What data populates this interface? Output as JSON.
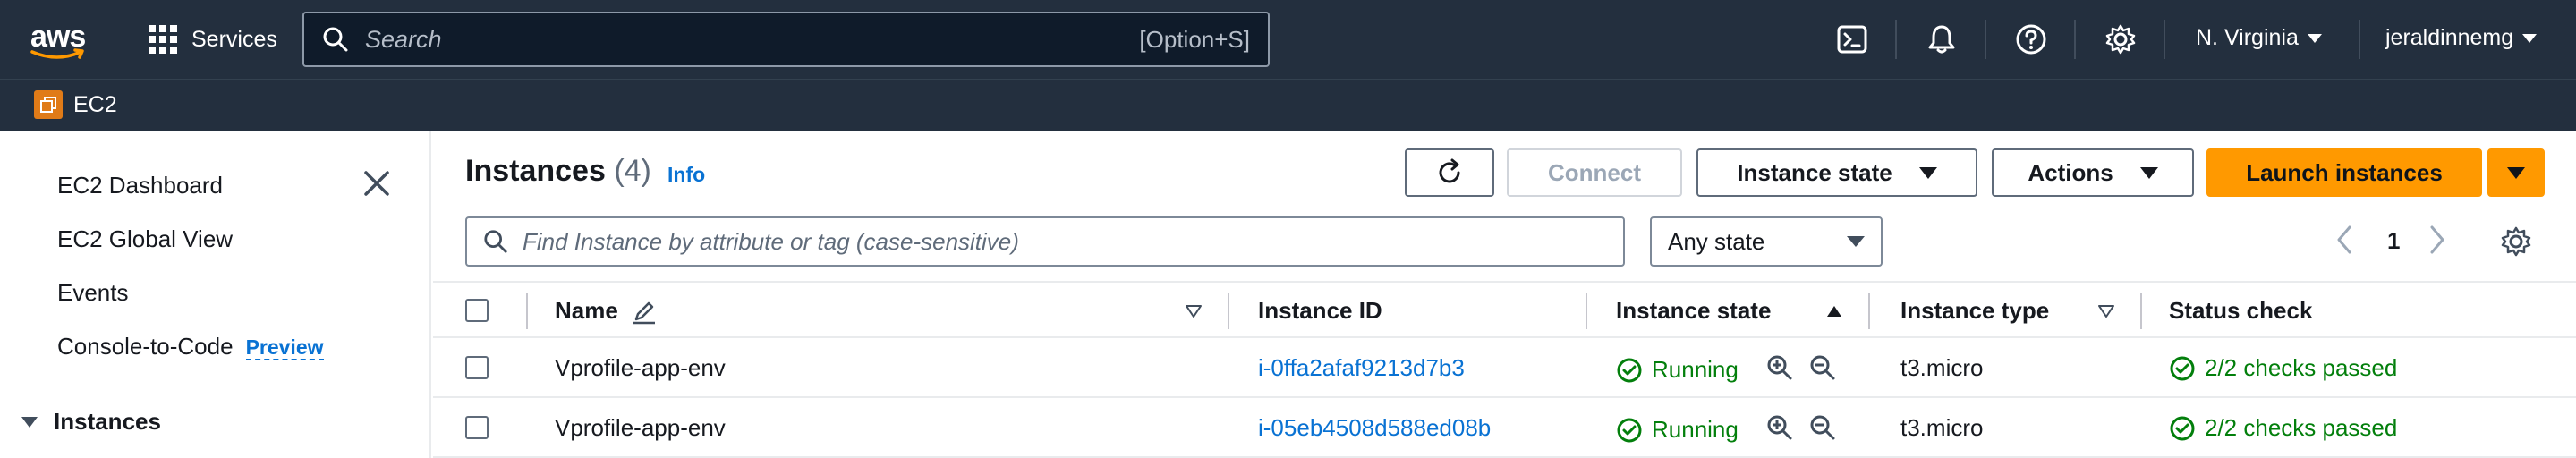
{
  "topnav": {
    "logo_text": "aws",
    "services_label": "Services",
    "search_placeholder": "Search",
    "search_shortcut": "[Option+S]",
    "region": "N. Virginia",
    "user": "jeraldinnemg"
  },
  "servicebar": {
    "service": "EC2"
  },
  "sidebar": {
    "items": [
      {
        "label": "EC2 Dashboard"
      },
      {
        "label": "EC2 Global View"
      },
      {
        "label": "Events"
      },
      {
        "label": "Console-to-Code"
      }
    ],
    "preview_label": "Preview",
    "section": "Instances"
  },
  "main": {
    "title": "Instances",
    "count": "(4)",
    "info": "Info",
    "connect_label": "Connect",
    "instance_state_label": "Instance state",
    "actions_label": "Actions",
    "launch_label": "Launch instances",
    "filter_placeholder": "Find Instance by attribute or tag (case-sensitive)",
    "state_filter": "Any state",
    "page": "1"
  },
  "table": {
    "columns": [
      "Name",
      "Instance ID",
      "Instance state",
      "Instance type",
      "Status check"
    ],
    "rows": [
      {
        "name": "Vprofile-app-env",
        "id": "i-0ffa2afaf9213d7b3",
        "state": "Running",
        "type": "t3.micro",
        "status": "2/2 checks passed"
      },
      {
        "name": "Vprofile-app-env",
        "id": "i-05eb4508d588ed08b",
        "state": "Running",
        "type": "t3.micro",
        "status": "2/2 checks passed"
      }
    ]
  },
  "colors": {
    "nav_bg": "#232f3e",
    "primary": "#ff9900",
    "link": "#0972d3",
    "success": "#037f0c"
  },
  "icons": {
    "search": "search-icon",
    "cloudshell": "cloudshell-icon",
    "notifications": "bell-icon",
    "help": "help-icon",
    "settings": "gear-icon",
    "refresh": "refresh-icon",
    "zoom_in": "zoom-in-icon",
    "zoom_out": "zoom-out-icon"
  }
}
